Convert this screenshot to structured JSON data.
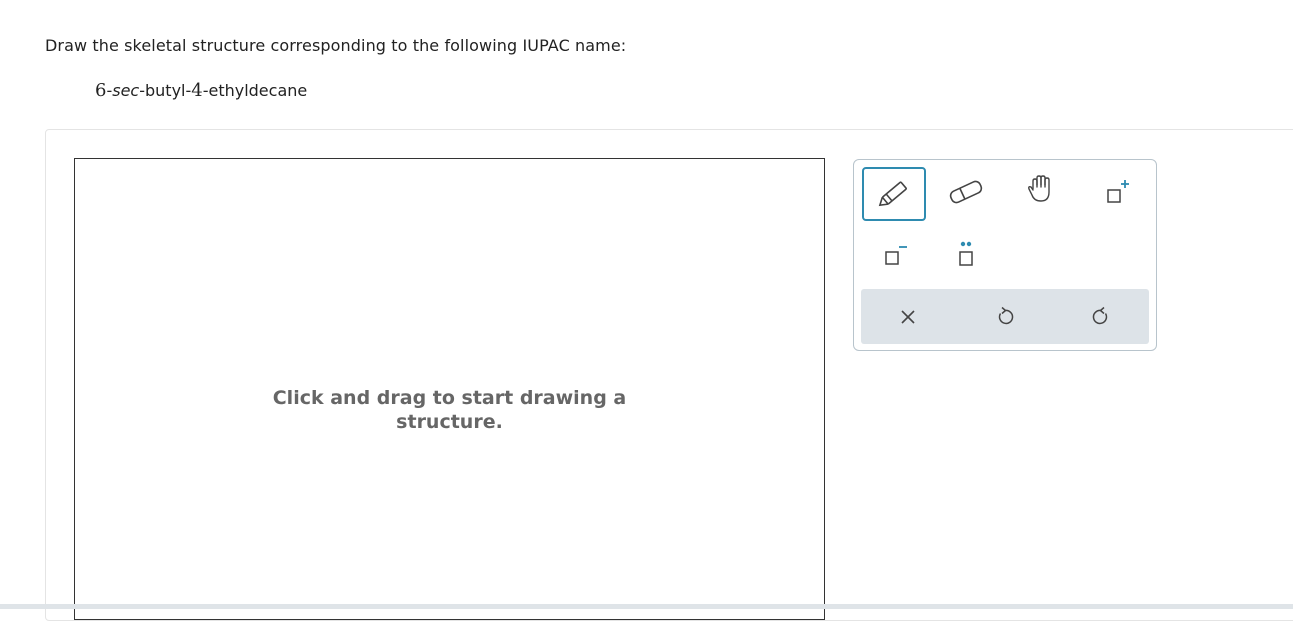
{
  "prompt": "Draw the skeletal structure corresponding to the following IUPAC name:",
  "compound": {
    "n1": "6",
    "sep1": "-",
    "italic": "sec",
    "part2": "-butyl-",
    "n2": "4",
    "part3": "-ethyldecane"
  },
  "canvas": {
    "hint_line1": "Click and drag to start drawing a",
    "hint_line2": "structure."
  },
  "toolbar": {
    "tools": [
      "pencil-icon",
      "eraser-icon",
      "hand-icon",
      "add-charge-icon",
      "subtract-charge-icon",
      "lone-pair-icon"
    ],
    "actions": [
      "clear-icon",
      "undo-icon",
      "redo-icon"
    ],
    "accent": "#2e8bb0"
  }
}
